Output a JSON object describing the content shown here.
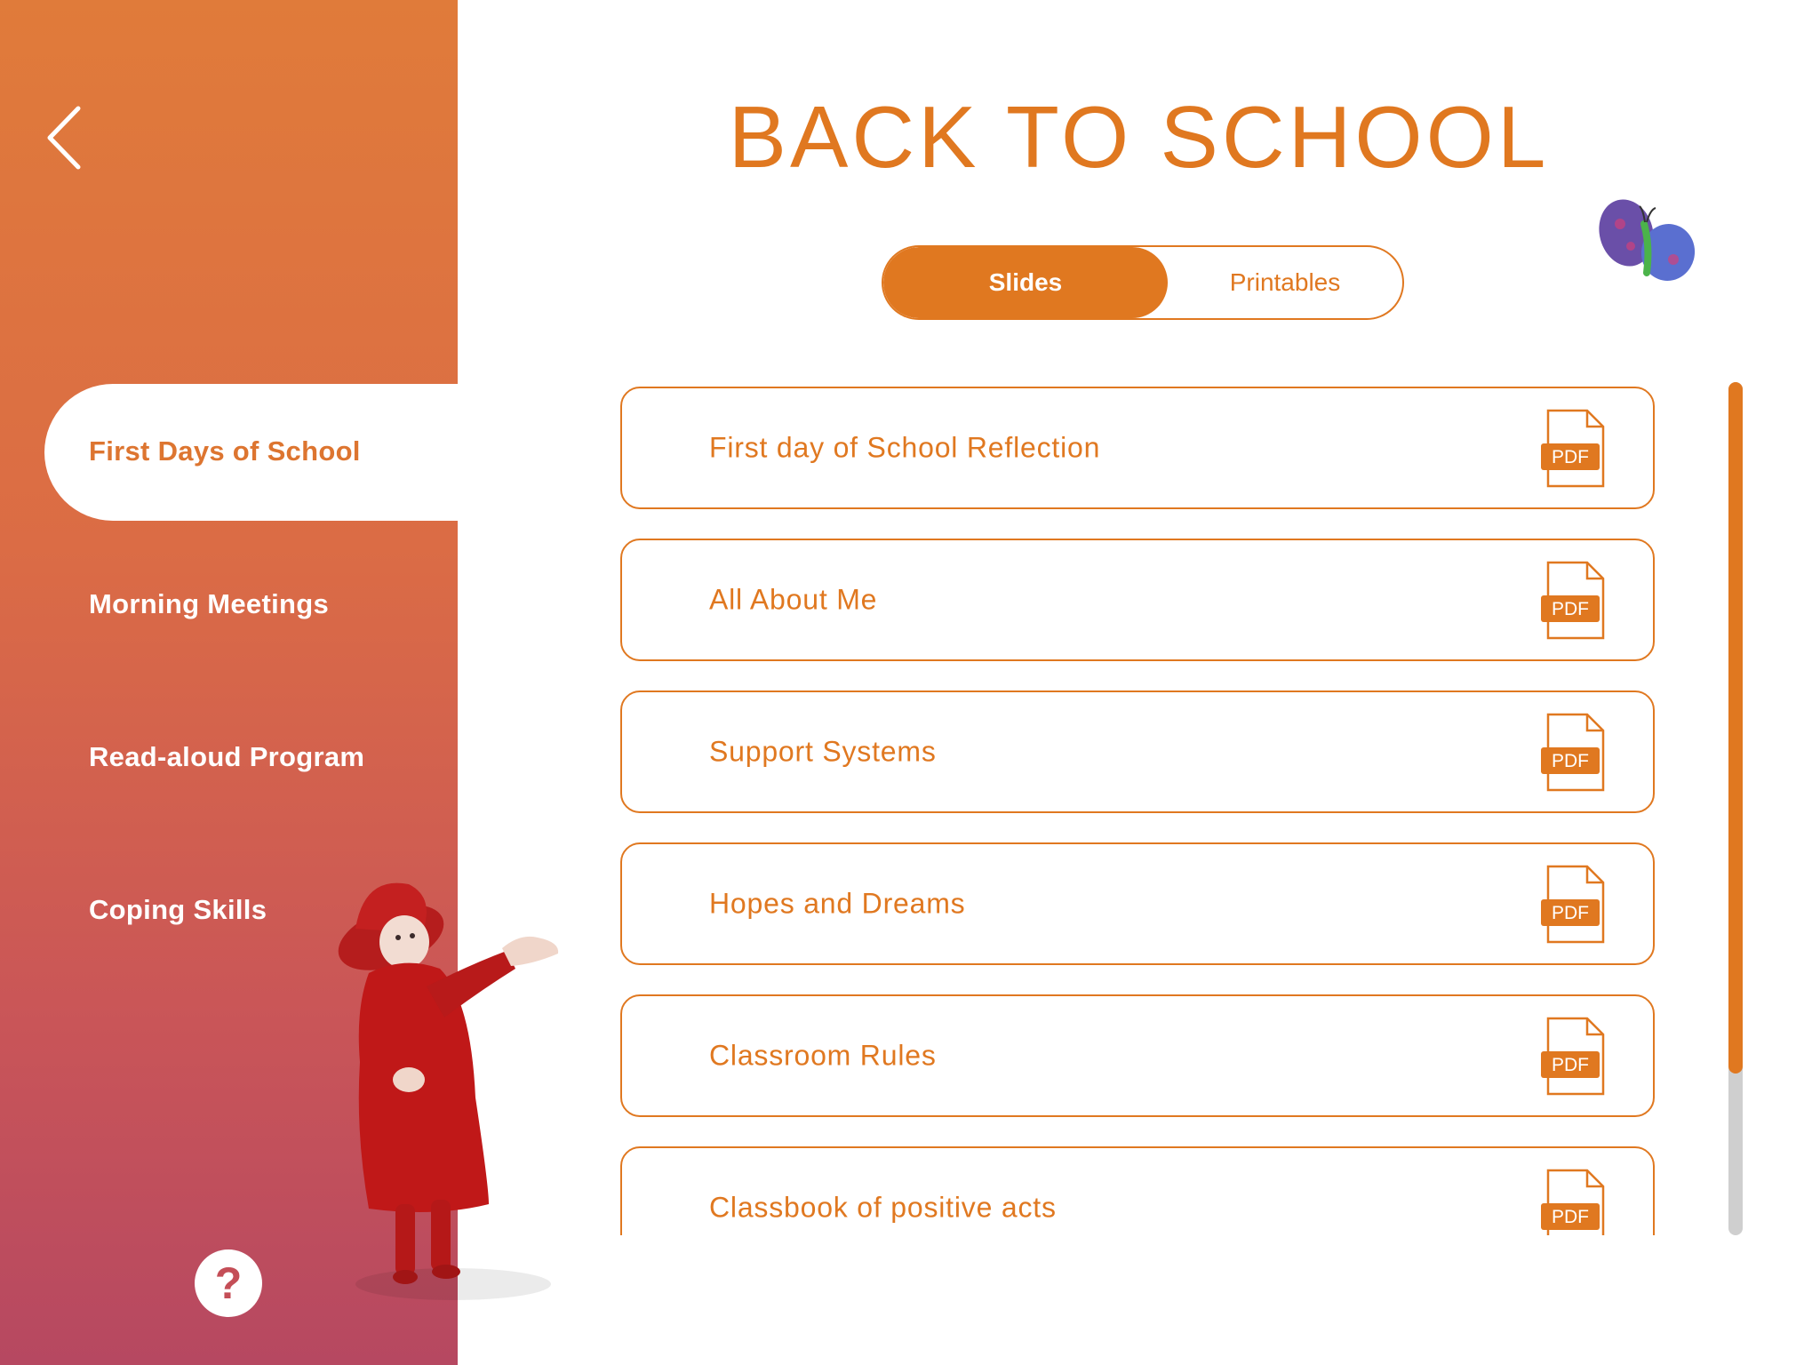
{
  "sidebar": {
    "items": [
      {
        "label": "First Days of School",
        "active": true
      },
      {
        "label": "Morning Meetings",
        "active": false
      },
      {
        "label": "Read-aloud Program",
        "active": false
      },
      {
        "label": "Coping Skills",
        "active": false
      }
    ],
    "help_label": "?"
  },
  "header": {
    "title": "BACK TO SCHOOL"
  },
  "segmented": {
    "options": [
      "Slides",
      "Printables"
    ],
    "selected": "Slides"
  },
  "resources": [
    {
      "title": "First day of School Reflection",
      "badge": "PDF"
    },
    {
      "title": "All About Me",
      "badge": "PDF"
    },
    {
      "title": "Support Systems",
      "badge": "PDF"
    },
    {
      "title": "Hopes and Dreams",
      "badge": "PDF"
    },
    {
      "title": "Classroom Rules",
      "badge": "PDF"
    },
    {
      "title": "Classbook of positive acts",
      "badge": "PDF"
    }
  ],
  "colors": {
    "accent": "#e07820",
    "sidebar_top": "#e07b3a",
    "sidebar_bottom": "#b64861",
    "scroll_track": "#cfcfcf"
  },
  "icons": {
    "back": "chevron-left-icon",
    "help": "question-mark-icon",
    "file": "pdf-file-icon"
  },
  "scroll": {
    "visible_fraction": 0.81
  }
}
